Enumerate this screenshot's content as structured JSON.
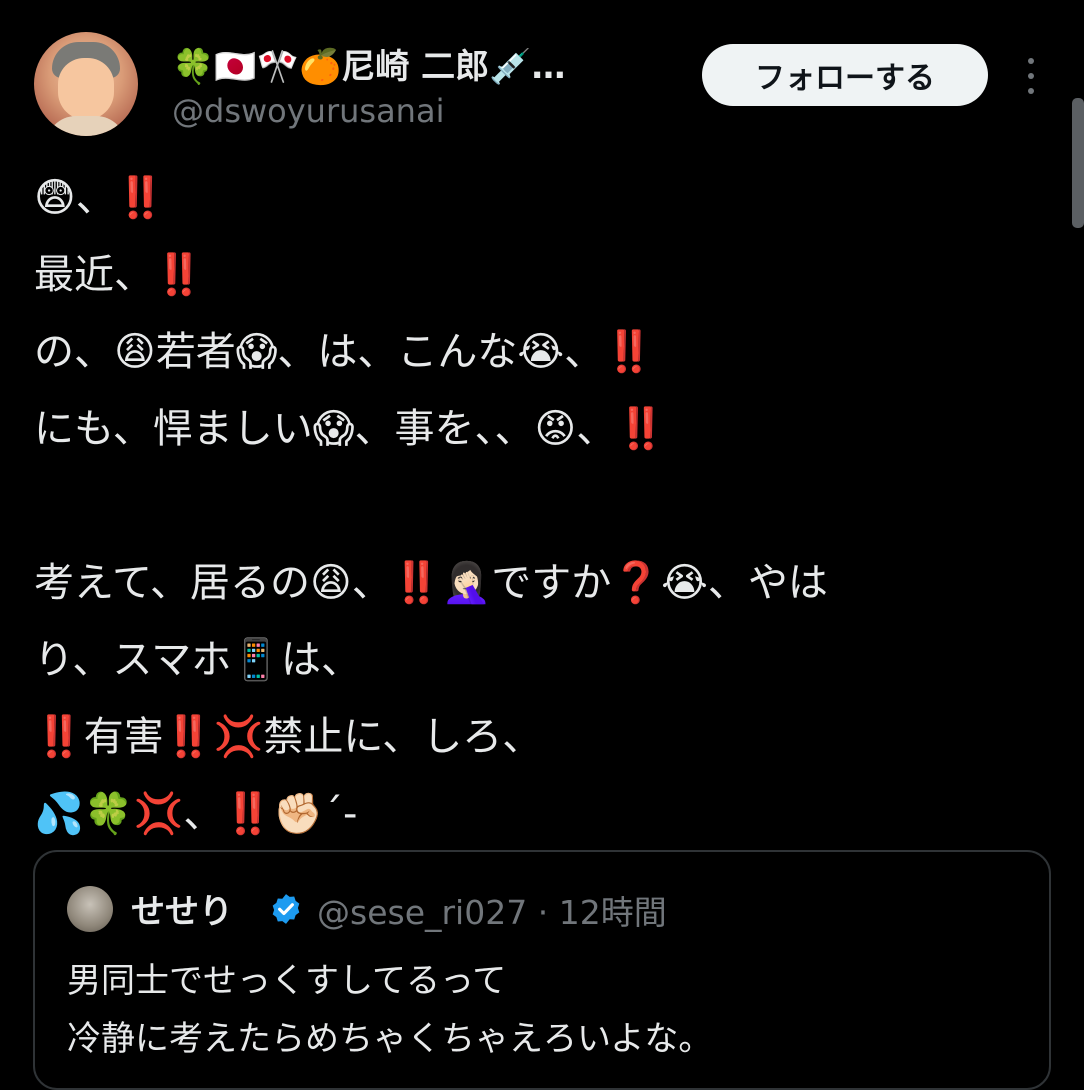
{
  "post": {
    "author_name": "🍀🇯🇵🎌🍊尼崎 二郎💉…",
    "handle": "@dswoyurusanai",
    "follow_label": "フォローする",
    "body_lines": [
      "😨、‼️",
      "最近、‼️",
      "の、😩若者😱、は、こんな😭、‼️",
      "にも、悍ましい😱、事を、、😡、‼️",
      "",
      "考えて、居るの😩、‼️🤦🏻‍♀️ですか❓😭、やは",
      "り、スマホ📱は、",
      "‼️有害‼️💢禁止に、しろ、",
      "💦🍀💢、‼️✊🏻´-"
    ]
  },
  "quote": {
    "name": "せせり",
    "handle": "@sese_ri027",
    "separator": "·",
    "time": "12時間",
    "text_lines": [
      "男同士でせっくすしてるって",
      "冷静に考えたらめちゃくちゃえろいよな。"
    ]
  },
  "icons": {
    "avatar": "user-avatar",
    "more": "more-options-icon",
    "verified": "verified-badge-icon"
  },
  "colors": {
    "background": "#000000",
    "text": "#e7e9ea",
    "muted": "#71767b",
    "verified": "#1d9bf0",
    "button_bg": "#eff3f4"
  }
}
